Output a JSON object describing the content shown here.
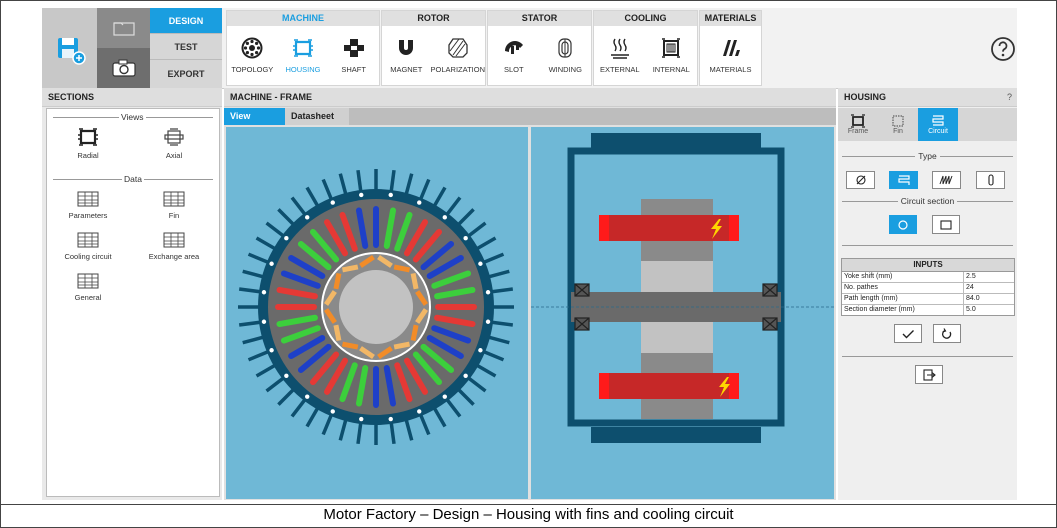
{
  "ribbon": {
    "modes": [
      {
        "label": "DESIGN",
        "active": true
      },
      {
        "label": "TEST",
        "active": false
      },
      {
        "label": "EXPORT",
        "active": false
      }
    ],
    "groups": [
      {
        "title": "MACHINE",
        "active": true,
        "items": [
          {
            "label": "TOPOLOGY",
            "icon": "topology-icon",
            "active": false
          },
          {
            "label": "HOUSING",
            "icon": "housing-icon",
            "active": true
          },
          {
            "label": "SHAFT",
            "icon": "shaft-icon",
            "active": false
          }
        ]
      },
      {
        "title": "ROTOR",
        "active": false,
        "items": [
          {
            "label": "MAGNET",
            "icon": "magnet-icon",
            "active": false
          },
          {
            "label": "POLARIZATION",
            "icon": "polarization-icon",
            "active": false
          }
        ]
      },
      {
        "title": "STATOR",
        "active": false,
        "items": [
          {
            "label": "SLOT",
            "icon": "slot-icon",
            "active": false
          },
          {
            "label": "WINDING",
            "icon": "winding-icon",
            "active": false
          }
        ]
      },
      {
        "title": "COOLING",
        "active": false,
        "items": [
          {
            "label": "EXTERNAL",
            "icon": "external-cooling-icon",
            "active": false
          },
          {
            "label": "INTERNAL",
            "icon": "internal-cooling-icon",
            "active": false
          }
        ]
      },
      {
        "title": "MATERIALS",
        "active": false,
        "items": [
          {
            "label": "MATERIALS",
            "icon": "materials-icon",
            "active": false
          }
        ]
      }
    ]
  },
  "sections": {
    "title": "SECTIONS",
    "views_label": "Views",
    "data_label": "Data",
    "views": [
      {
        "label": "Radial",
        "icon": "radial-view-icon"
      },
      {
        "label": "Axial",
        "icon": "axial-view-icon"
      }
    ],
    "data": [
      {
        "label": "Parameters",
        "icon": "table-icon"
      },
      {
        "label": "Fin",
        "icon": "table-icon"
      },
      {
        "label": "Cooling circuit",
        "icon": "table-icon"
      },
      {
        "label": "Exchange area",
        "icon": "table-icon"
      },
      {
        "label": "General",
        "icon": "table-icon"
      }
    ]
  },
  "main": {
    "title": "MACHINE - FRAME",
    "tabs": [
      {
        "label": "View",
        "active": true
      },
      {
        "label": "Datasheet",
        "active": false
      }
    ]
  },
  "housing": {
    "title": "HOUSING",
    "help": "?",
    "tabs": [
      {
        "label": "Frame",
        "active": false
      },
      {
        "label": "Fin",
        "active": false
      },
      {
        "label": "Circuit",
        "active": true
      }
    ],
    "type_label": "Type",
    "circuit_section_label": "Circuit section",
    "inputs_title": "INPUTS",
    "inputs": [
      {
        "label": "Yoke shift (mm)",
        "value": "2.5"
      },
      {
        "label": "No. pathes",
        "value": "24"
      },
      {
        "label": "Path length (mm)",
        "value": "84.0"
      },
      {
        "label": "Section diameter (mm)",
        "value": "5.0"
      }
    ]
  },
  "caption": "Motor Factory – Design – Housing with fins and cooling circuit",
  "colors": {
    "accent": "#1a9ee0",
    "view_bg": "#6fb8d6",
    "housing_dark": "#0d4f6e"
  }
}
